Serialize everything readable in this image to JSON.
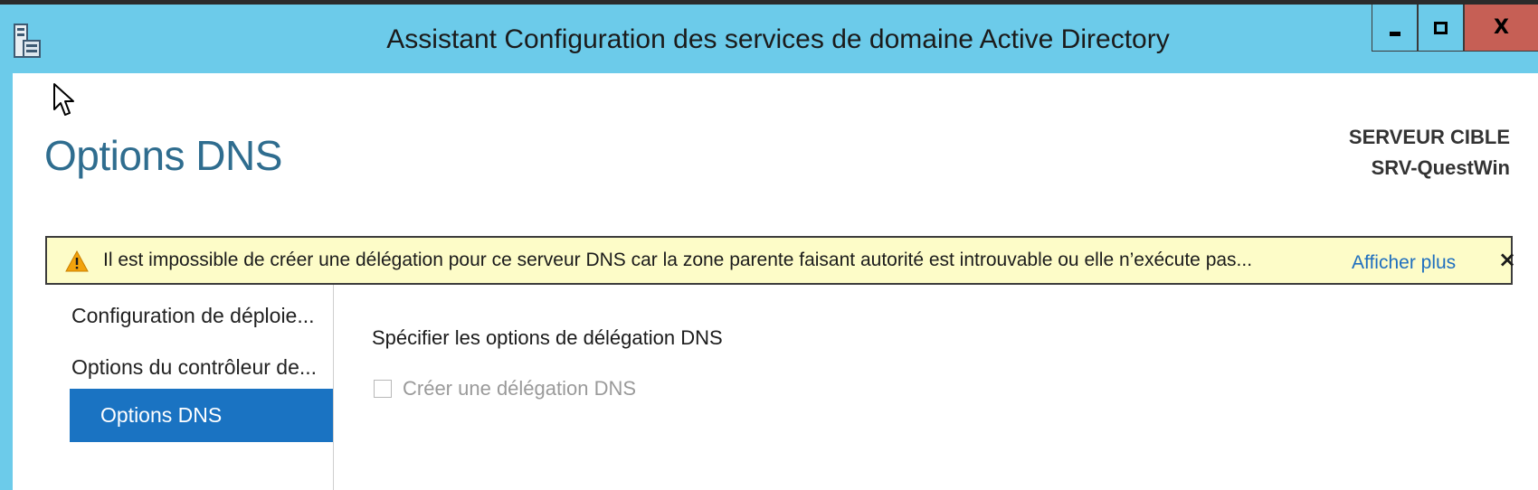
{
  "window": {
    "title": "Assistant Configuration des services de domaine Active Directory",
    "controls": {
      "minimize": "minimize-icon",
      "maximize": "maximize-icon",
      "close": "X"
    }
  },
  "header": {
    "page_title": "Options DNS",
    "target_label": "SERVEUR CIBLE",
    "target_name": "SRV-QuestWin"
  },
  "warning": {
    "icon": "warning-icon",
    "message": "Il est impossible de créer une délégation pour ce serveur DNS car la zone parente faisant autorité est introuvable ou elle n’exécute pas...",
    "link": "Afficher plus",
    "close": "×"
  },
  "nav": {
    "items": [
      {
        "label": "Configuration de déploie..."
      },
      {
        "label": "Options du contrôleur de..."
      },
      {
        "label": "Options DNS",
        "selected": true
      }
    ]
  },
  "content": {
    "heading": "Spécifier les options de délégation DNS",
    "checkbox": {
      "label": "Créer une délégation DNS",
      "checked": false,
      "enabled": false
    }
  },
  "colors": {
    "titlebar": "#6ccbea",
    "close_button": "#c65f55",
    "accent": "#1a73c2",
    "warning_bg": "#fdfcc8",
    "title_text": "#2f6d8f",
    "link": "#1f6fbf"
  }
}
